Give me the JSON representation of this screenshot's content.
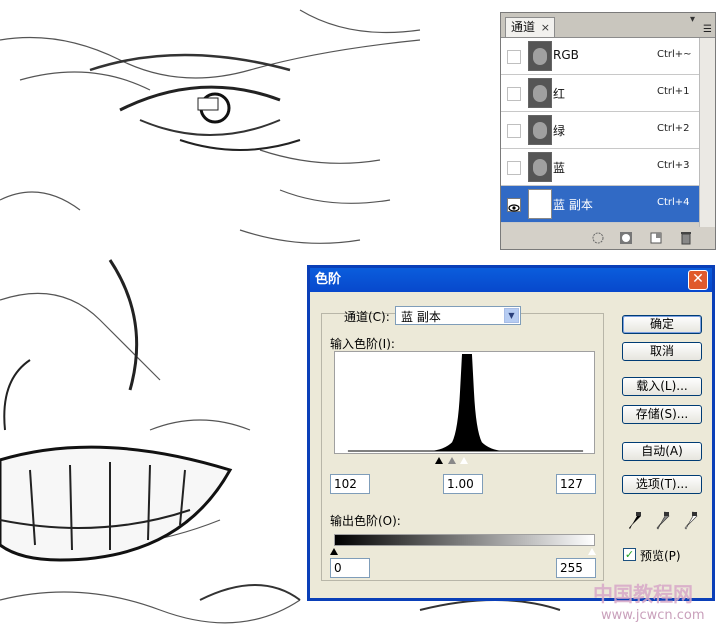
{
  "channels_panel": {
    "tab_label": "通道",
    "tab_close": "×",
    "minimize_glyph": "▾",
    "menu_glyph": "☰",
    "rows": [
      {
        "name": "RGB",
        "shortcut": "Ctrl+~",
        "selected": false,
        "visible": false
      },
      {
        "name": "红",
        "shortcut": "Ctrl+1",
        "selected": false,
        "visible": false
      },
      {
        "name": "绿",
        "shortcut": "Ctrl+2",
        "selected": false,
        "visible": false
      },
      {
        "name": "蓝",
        "shortcut": "Ctrl+3",
        "selected": false,
        "visible": false
      },
      {
        "name": "蓝 副本",
        "shortcut": "Ctrl+4",
        "selected": true,
        "visible": true
      }
    ],
    "footer_icons": [
      "load-selection-icon",
      "save-selection-icon",
      "new-channel-icon",
      "delete-channel-icon"
    ]
  },
  "levels_dialog": {
    "title": "色阶",
    "close_glyph": "✕",
    "channel_label": "通道(C):",
    "channel_value": "蓝 副本",
    "input_levels_label": "输入色阶(I):",
    "input_black": "102",
    "input_gamma": "1.00",
    "input_white": "127",
    "output_levels_label": "输出色阶(O):",
    "output_black": "0",
    "output_white": "255",
    "buttons": {
      "ok": "确定",
      "cancel": "取消",
      "load": "载入(L)...",
      "save": "存储(S)...",
      "auto": "自动(A)",
      "options": "选项(T)..."
    },
    "preview_label": "预览(P)",
    "preview_checked": true,
    "eyedropper_icons": [
      "black-eyedropper-icon",
      "gray-eyedropper-icon",
      "white-eyedropper-icon"
    ]
  },
  "watermark": {
    "text_top": "中国教程网",
    "text_bottom": "www.jcwcn.com"
  },
  "colors": {
    "selection": "#316ac5",
    "titlebar": "#0a5ddc",
    "dialog_bg": "#ece9d8"
  }
}
